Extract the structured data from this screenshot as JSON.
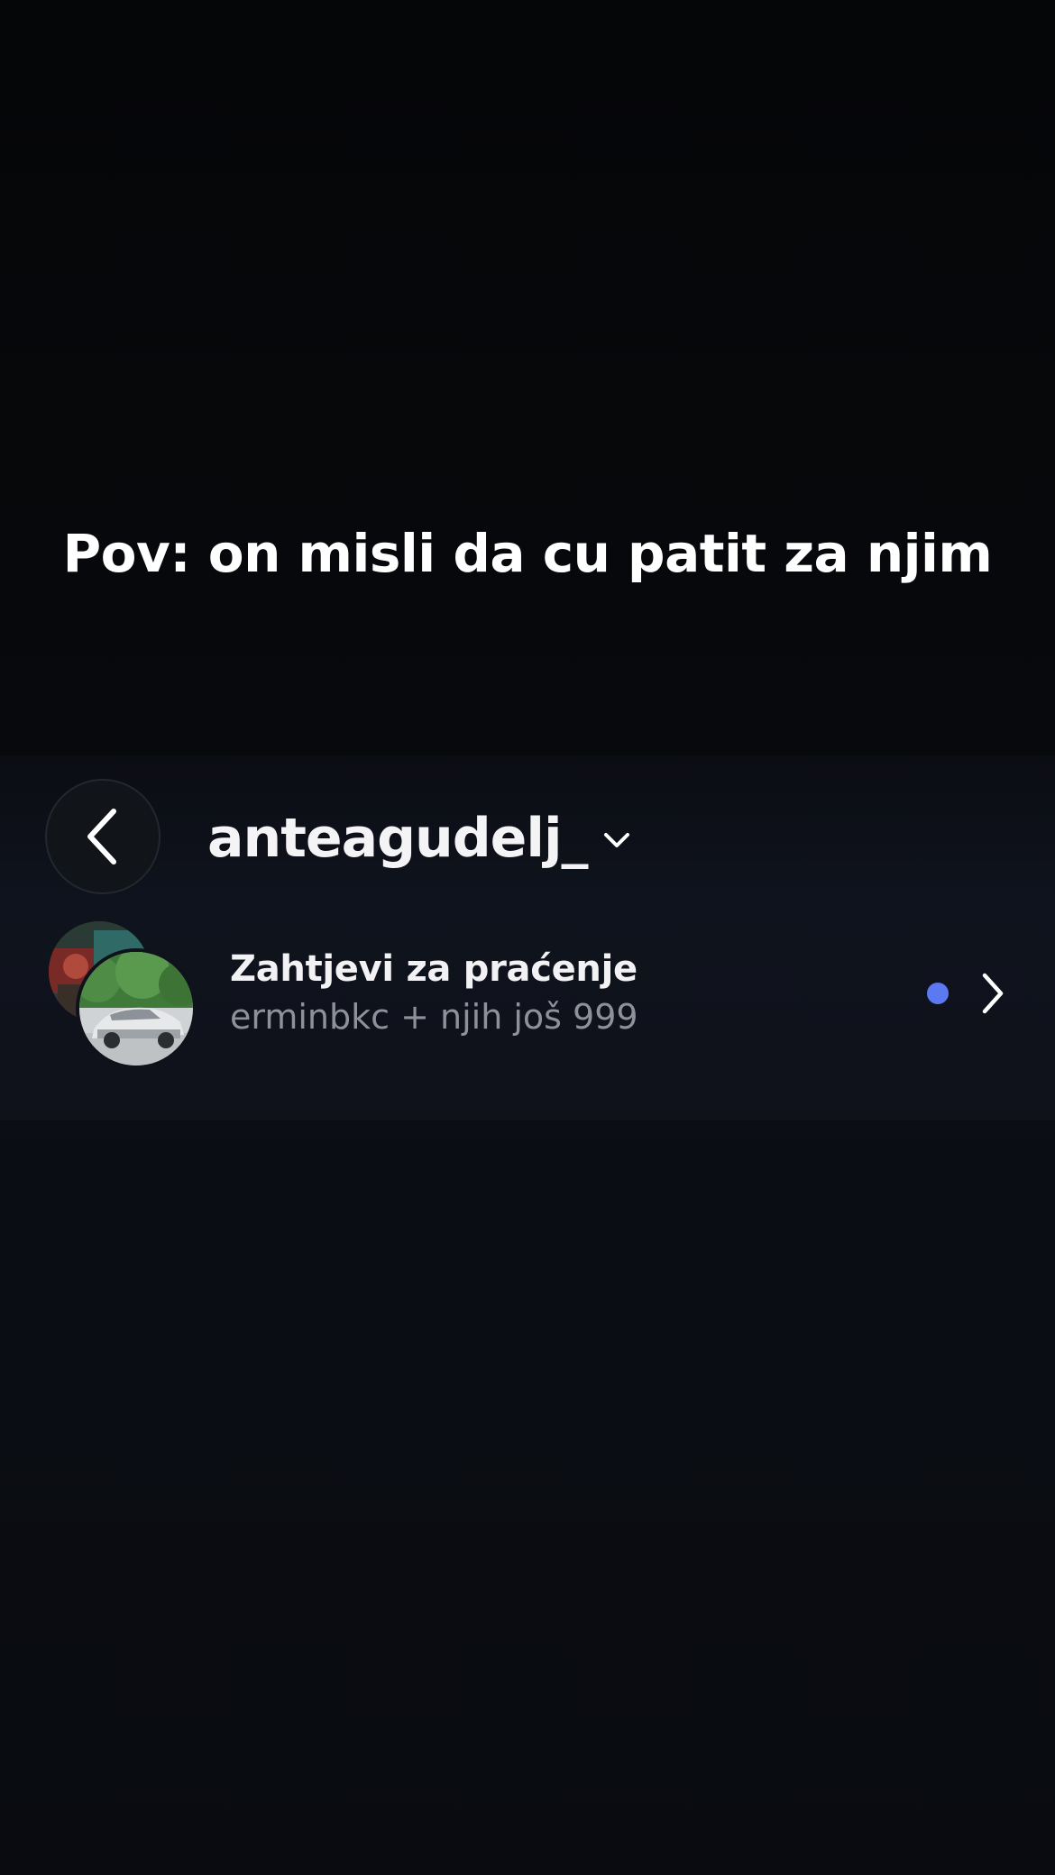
{
  "caption": "Pov: on misli da cu patit za njim",
  "header": {
    "back_icon": "chevron-left-icon",
    "username": "anteagudelj_",
    "dropdown_icon": "chevron-down-icon"
  },
  "follow_requests": {
    "title": "Zahtjevi za praćenje",
    "subtitle": "erminbkc + njih još 999",
    "unread_dot_color": "#5b79f0",
    "arrow_icon": "chevron-right-icon"
  }
}
